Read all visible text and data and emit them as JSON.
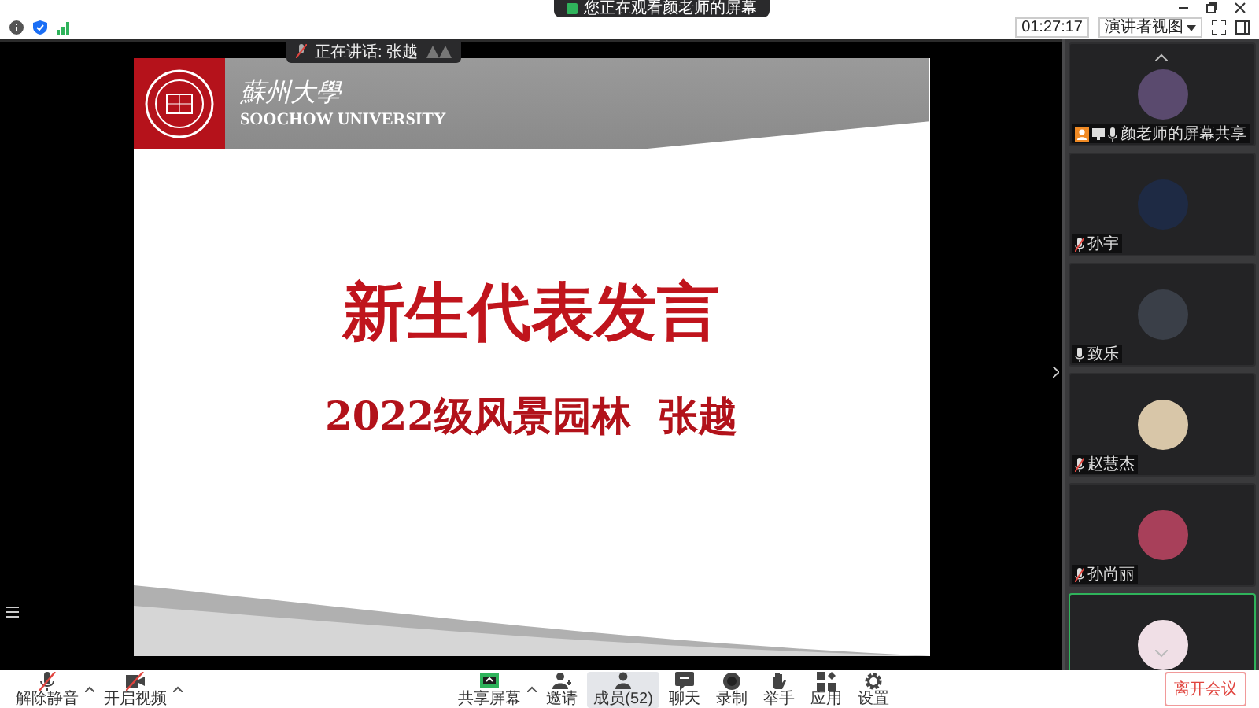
{
  "window": {
    "viewing_banner": "您正在观看颜老师的屏幕",
    "speaking_banner": "正在讲话: 张越",
    "timer": "01:27:17",
    "view_mode": "演讲者视图"
  },
  "slide": {
    "logo_cn": "蘇州大學",
    "logo_en": "SOOCHOW UNIVERSITY",
    "title": "新生代表发言",
    "subtitle": "2022级风景园林  张越"
  },
  "participants": [
    {
      "name": "颜老师的屏幕共享",
      "host": true,
      "muted": false,
      "speaking": false,
      "color": "#5a4a6e"
    },
    {
      "name": "孙宇",
      "host": false,
      "muted": true,
      "speaking": false,
      "color": "#1e2a44"
    },
    {
      "name": "致乐",
      "host": false,
      "muted": false,
      "speaking": false,
      "color": "#3a3f48"
    },
    {
      "name": "赵慧杰",
      "host": false,
      "muted": true,
      "speaking": false,
      "color": "#d8c6a8"
    },
    {
      "name": "孙尚丽",
      "host": false,
      "muted": true,
      "speaking": false,
      "color": "#a8405a"
    },
    {
      "host": false,
      "muted": false,
      "speaking": true,
      "color": "#f0dfe6"
    }
  ],
  "toolbar": {
    "left": [
      {
        "kind": "mic",
        "label": "解除静音",
        "caret": true,
        "selected": false
      },
      {
        "kind": "video",
        "label": "开启视频",
        "caret": true,
        "selected": false
      }
    ],
    "center": [
      {
        "kind": "share",
        "label": "共享屏幕",
        "caret": true,
        "selected": false
      },
      {
        "kind": "invite",
        "label": "邀请",
        "caret": false,
        "selected": false
      },
      {
        "kind": "members",
        "label": "成员(52)",
        "caret": false,
        "selected": true
      },
      {
        "kind": "chat",
        "label": "聊天",
        "caret": false,
        "selected": false
      },
      {
        "kind": "record",
        "label": "录制",
        "caret": false,
        "selected": false
      },
      {
        "kind": "hand",
        "label": "举手",
        "caret": false,
        "selected": false
      },
      {
        "kind": "apps",
        "label": "应用",
        "caret": false,
        "selected": false
      },
      {
        "kind": "settings",
        "label": "设置",
        "caret": false,
        "selected": false
      }
    ],
    "leave": "离开会议"
  }
}
